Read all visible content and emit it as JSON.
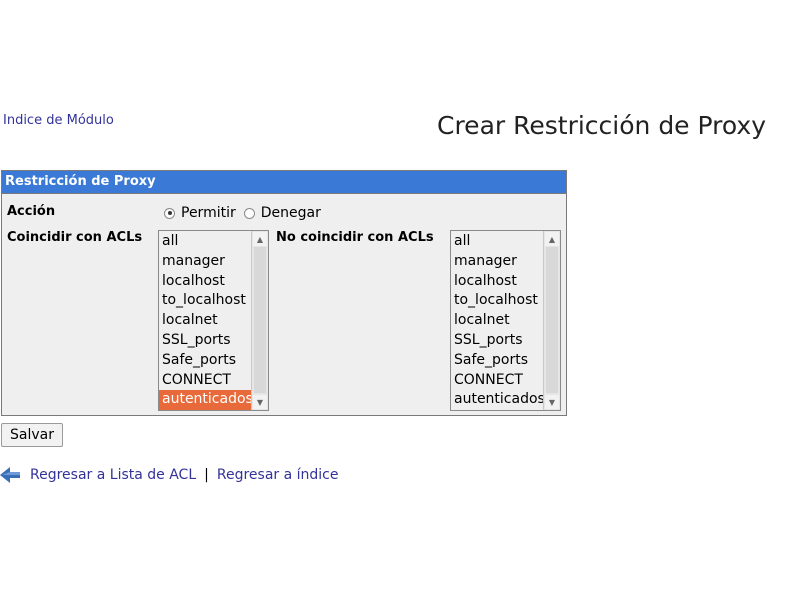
{
  "header": {
    "module_index_link": "Indice de Módulo",
    "page_title": "Crear Restricción de Proxy"
  },
  "panel": {
    "title": "Restricción de Proxy",
    "action_label": "Acción",
    "radio_options": [
      {
        "label": "Permitir",
        "checked": true
      },
      {
        "label": "Denegar",
        "checked": false
      }
    ],
    "match_label": "Coincidir con ACLs",
    "no_match_label": "No coincidir con ACLs",
    "match_acls": {
      "options": [
        "all",
        "manager",
        "localhost",
        "to_localhost",
        "localnet",
        "SSL_ports",
        "Safe_ports",
        "CONNECT",
        "autenticados"
      ],
      "selected": [
        "autenticados"
      ]
    },
    "no_match_acls": {
      "options": [
        "all",
        "manager",
        "localhost",
        "to_localhost",
        "localnet",
        "SSL_ports",
        "Safe_ports",
        "CONNECT",
        "autenticados"
      ],
      "selected": []
    }
  },
  "save_button": "Salvar",
  "footer": {
    "back_acl_list": "Regresar a Lista de ACL",
    "separator": "|",
    "back_index": "Regresar a índice"
  },
  "colors": {
    "panel_header": "#3a7ad6",
    "selected_option": "#e86a3a",
    "link": "#333399"
  },
  "icons": {
    "back_arrow": "back-arrow-icon",
    "scroll_up": "chevron-up-icon",
    "scroll_down": "chevron-down-icon"
  }
}
